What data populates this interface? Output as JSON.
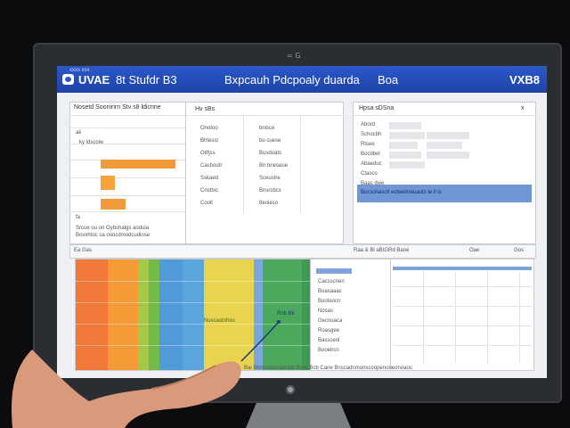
{
  "monitor": {
    "camera_label": "= G"
  },
  "titlebar": {
    "left_small": "xxxx xxx",
    "brand": "UVAE",
    "title_a": "8t   Stufdr   B3",
    "title_b": "Bxpcauh Pdcpoaly duarda",
    "title_c": "Boa",
    "right": "VXB8"
  },
  "top_left_panel": {
    "header": "Nosetd Soonirirn Stv s8 ldicnne",
    "col1": [
      "ak",
      "ky ldscoiw",
      "",
      "",
      "",
      "fa"
    ],
    "caption1": "Srcue ou on Oybshalgs aoduia",
    "caption2": "Bovxhtoc sa ooocdmodcudiose"
  },
  "top_middle_panel": {
    "header": "Hv sBs",
    "left_col": [
      "Onotoo",
      "Bhtesst",
      "Oitfjss",
      "Cashoutr",
      "Sskaed",
      "Cnsttxc",
      "Cooll"
    ],
    "right_col": [
      "bnlsce",
      "bu cuese",
      "Busdoats",
      "Bn bneseue",
      "Sceustre",
      "Bnsrcbcs",
      "8eoieso"
    ]
  },
  "top_right_panel": {
    "header": "Hpsa sDSna",
    "close": "x",
    "rows": [
      "Abord",
      "Schocbh",
      "Rtsee",
      "Bocdbel",
      "Abaeduc",
      "Ctasco",
      "Baas dwe"
    ],
    "band_text": "Bocsonasclt ecbeehreuauts te ll ls"
  },
  "bottom_bar": {
    "left": "Ea Gas",
    "middle": "Raa & Bl aBtGRd   Baoe",
    "right1": "Oae",
    "right2": "Gos"
  },
  "bottom_left_chart": {
    "series_label": "Noscastnhsu",
    "callout": "Rnb Bk"
  },
  "bottom_middle_list": {
    "items": [
      "Cacsscnen",
      "Boasaaac",
      "Booteocn",
      "Nosas",
      "Gecouaca",
      "Roasgee",
      "Bassceol",
      "Booelrcn"
    ]
  },
  "footer": {
    "text": "Bai  Bbnsscunnaeddb  Bosc  Bcb  Cane  Bnscadnmonscoopenoneonoaos"
  },
  "colors": {
    "title_blue": "#2b57c9",
    "accent_orange": "#f29a3a",
    "band_blue": "#6f97d8"
  }
}
